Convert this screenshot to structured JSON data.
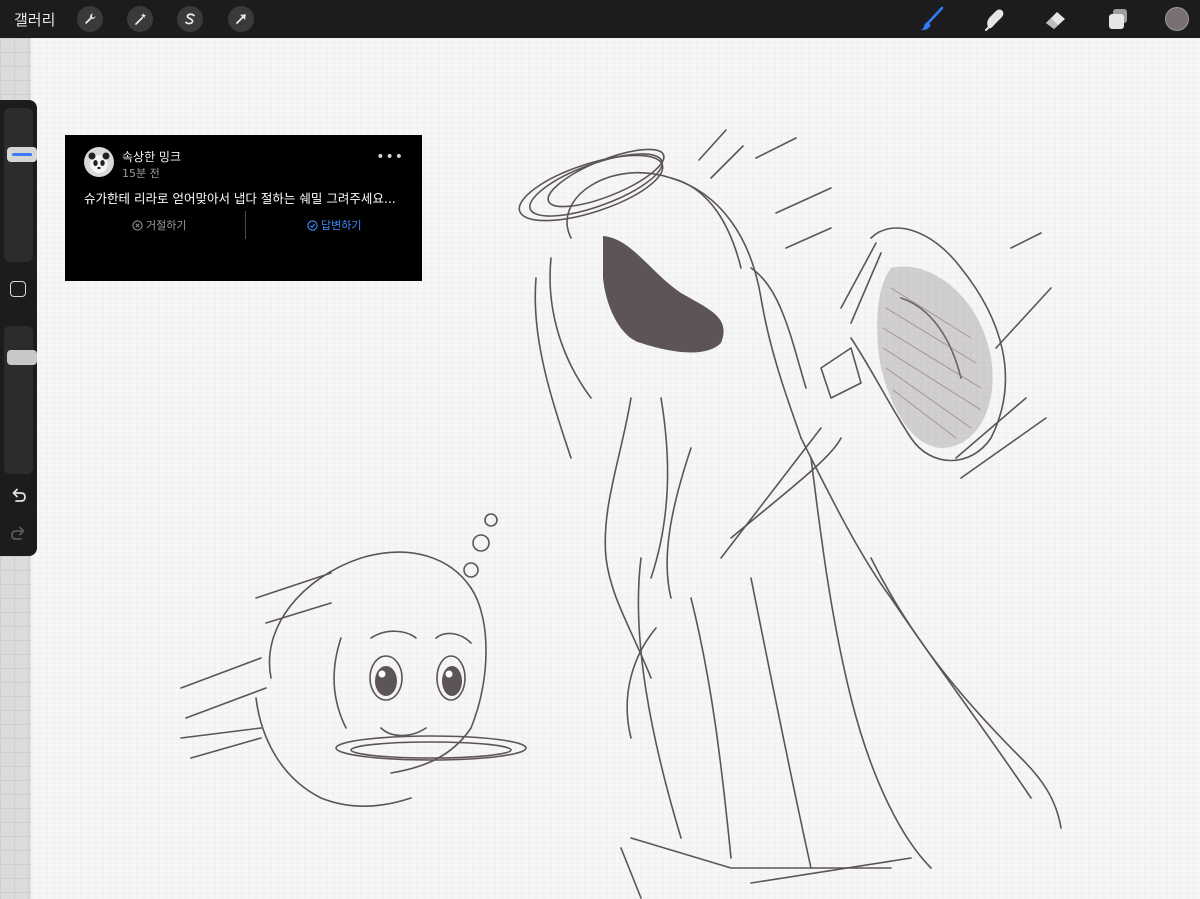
{
  "toolbar": {
    "gallery_label": "갤러리",
    "left_tools": [
      {
        "name": "wrench-icon",
        "tool": "actions"
      },
      {
        "name": "magic-wand-icon",
        "tool": "adjustments"
      },
      {
        "name": "selection-s-icon",
        "tool": "selection"
      },
      {
        "name": "arrow-cursor-icon",
        "tool": "transform"
      }
    ],
    "right_tools": [
      {
        "name": "brush-icon",
        "tool": "paint",
        "active": true
      },
      {
        "name": "smudge-icon",
        "tool": "smudge"
      },
      {
        "name": "eraser-icon",
        "tool": "erase"
      },
      {
        "name": "layers-icon",
        "tool": "layers"
      }
    ],
    "active_color": "#7a6f74",
    "active_tool_color": "#2f7cf6"
  },
  "sidebar": {
    "brush_size_level": 0.72,
    "opacity_level": 0.82,
    "size_accent": "#3a7bf2",
    "undo_icon": "undo-icon",
    "redo_icon": "redo-icon"
  },
  "notification": {
    "username": "속상한 밍크",
    "time": "15분 전",
    "message": "슈가한테 리라로 얻어맞아서 냅다 절하는 쉐밀 그려주세요...",
    "more_label": "•••",
    "reject_label": "거절하기",
    "reply_label": "답변하기",
    "reply_color": "#3e8dff"
  },
  "colors": {
    "toolbar_bg": "#1c1c1e",
    "canvas_bg": "#f7f7f6",
    "ink": "#5d5459"
  }
}
